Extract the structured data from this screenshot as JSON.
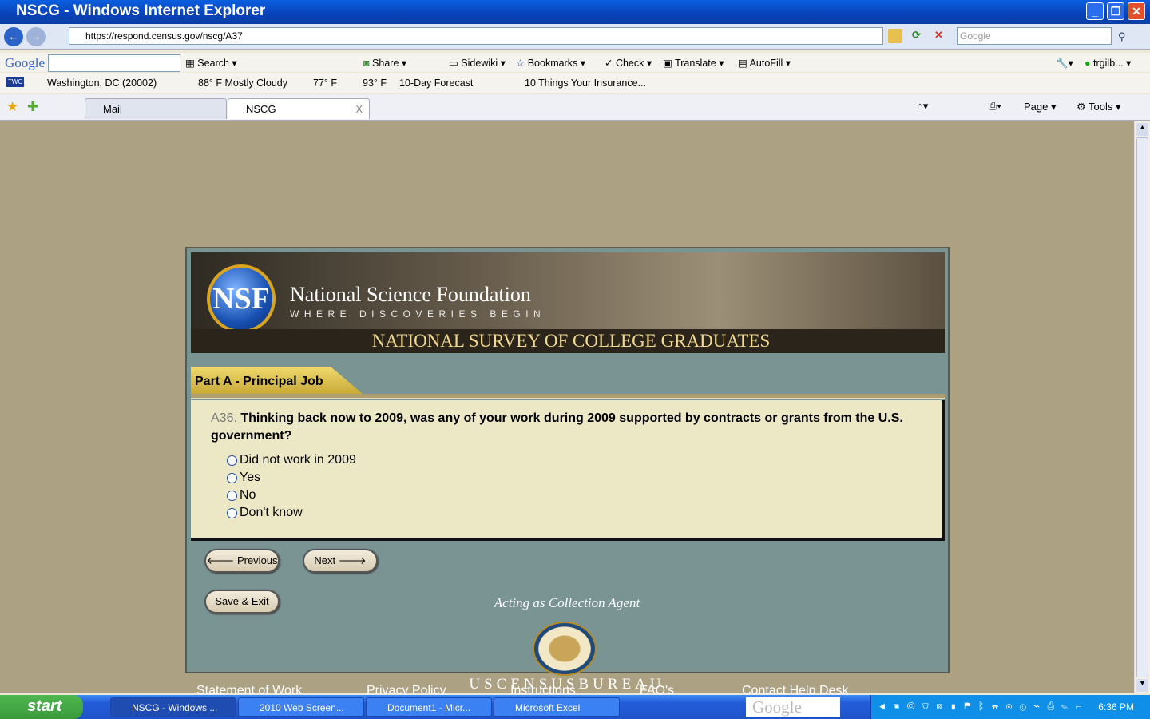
{
  "window": {
    "title": "NSCG - Windows Internet Explorer",
    "minimize": "_",
    "restore": "❐",
    "close": "✕"
  },
  "address": {
    "url": "https://respond.census.gov/nscg/A37",
    "search_placeholder": "Google"
  },
  "google_toolbar": {
    "logo": "Google",
    "search": "Search",
    "share": "Share",
    "sidewiki": "Sidewiki",
    "bookmarks": "Bookmarks",
    "check": "Check",
    "translate": "Translate",
    "autofill": "AutoFill",
    "user": "trgilb..."
  },
  "twc_toolbar": {
    "logo": "TWC",
    "location": "Washington, DC (20002)",
    "current": "88° F Mostly Cloudy",
    "low": "77° F",
    "high": "93° F",
    "forecast": "10-Day Forecast",
    "news": "10 Things Your Insurance..."
  },
  "tabs": [
    {
      "label": "Mail"
    },
    {
      "label": "NSCG",
      "close": "X",
      "active": true
    }
  ],
  "command_bar": {
    "page": "Page",
    "tools": "Tools"
  },
  "header": {
    "logo": "NSF",
    "org": "National Science Foundation",
    "tagline": "WHERE DISCOVERIES BEGIN",
    "survey": "NATIONAL SURVEY OF COLLEGE GRADUATES"
  },
  "section": {
    "title": "Part A - Principal Job"
  },
  "question": {
    "number": "A36.",
    "link_text": "Thinking back now to 2009",
    "text": ", was any of your work during 2009 supported by contracts or grants from the U.S. government?",
    "options": [
      "Did not work in 2009",
      "Yes",
      "No",
      "Don't know"
    ]
  },
  "buttons": {
    "previous": "Previous",
    "next": "Next",
    "save_exit": "Save & Exit"
  },
  "footer": {
    "links": [
      "Statement of Work",
      "Privacy Policy",
      "Instructions",
      "FAQ's",
      "Contact Help Desk"
    ],
    "agent": "Acting as Collection Agent",
    "bureau": "USCENSUSBUREAU"
  },
  "taskbar": {
    "start": "start",
    "tasks": [
      "NSCG - Windows ...",
      "2010 Web Screen...",
      "Document1 - Micr...",
      "Microsoft Excel"
    ],
    "google": "Google",
    "clock": "6:36 PM"
  }
}
